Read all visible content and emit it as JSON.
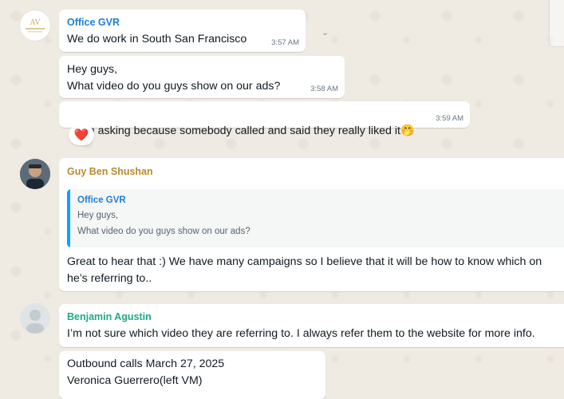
{
  "messages": {
    "office": {
      "sender": "Office GVR",
      "sender_color": "#1f7fd6",
      "m1": {
        "text": "We do work in South San Francisco",
        "time": "3:57 AM"
      },
      "m2": {
        "line1": "Hey guys,",
        "line2": "What video do you guys show on our ads?",
        "time": "3:58 AM"
      },
      "m3": {
        "text": "I’m asking because somebody called and said they really liked it",
        "time": "3:59 AM",
        "emoji": "🤭"
      },
      "reaction": "❤️"
    },
    "guy": {
      "sender": "Guy Ben Shushan",
      "sender_color": "#b78a2e",
      "quote": {
        "author": "Office GVR",
        "line1": "Hey guys,",
        "line2": "What video do you guys show on our ads?"
      },
      "line1": "Great to hear that :) We have many campaigns so I believe that it will be how to know which on",
      "line2": "he’s referring to.."
    },
    "benjamin": {
      "sender": "Benjamin Agustin",
      "sender_color": "#1fa88a",
      "m1": "I’m not sure which video they are referring to. I always refer them to the website for more info.",
      "m2_line1": "Outbound calls March 27, 2025",
      "m2_line2": "Veronica Guerrero(left VM)"
    }
  },
  "icons": {
    "dropdown": "chevron-down-icon",
    "reaction": "heart-icon"
  }
}
